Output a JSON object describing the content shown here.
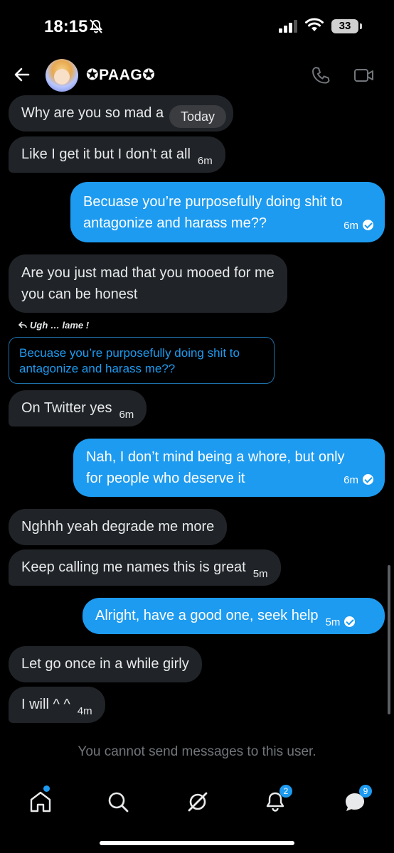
{
  "status_bar": {
    "time": "18:15",
    "battery": "33"
  },
  "header": {
    "contact_name": "✪PAAG✪"
  },
  "today_label": "Today",
  "messages": [
    {
      "text": "Why are you so mad a",
      "time": ""
    },
    {
      "text": "Like I get it but I don’t at all",
      "time": "6m"
    },
    {
      "line1": "Becuase you’re purposefully doing shit to",
      "line2": "antagonize and harass me??",
      "time": "6m"
    },
    {
      "line1": "Are you just mad that you mooed for me",
      "line2": "you can be honest"
    },
    {
      "text": "On Twitter yes",
      "time": "6m"
    },
    {
      "line1": "Nah, I don’t mind being a whore, but only",
      "line2": "for people who deserve it",
      "time": "6m"
    },
    {
      "text": "Nghhh yeah degrade me more"
    },
    {
      "text": "Keep calling me names this is great",
      "time": "5m"
    },
    {
      "text": "Alright, have a good one, seek help",
      "time": "5m"
    },
    {
      "text": "Let go once in a while girly"
    },
    {
      "text": "I will ^ ^",
      "time": "4m"
    }
  ],
  "reply": {
    "label": "Ugh … lame !",
    "quote_line1": "Becuase you’re purposefully doing shit to",
    "quote_line2": "antagonize and harass me??"
  },
  "footer_notice": "You cannot send messages to this user.",
  "nav": {
    "items": [
      "home-icon",
      "search-icon",
      "grok-icon",
      "notifications-icon",
      "messages-icon"
    ],
    "notifications_badge": "2",
    "messages_badge": "9"
  },
  "colors": {
    "accent": "#1d9bf0",
    "incoming_bubble": "#202327",
    "background": "#000000",
    "muted_text": "#71767b"
  }
}
